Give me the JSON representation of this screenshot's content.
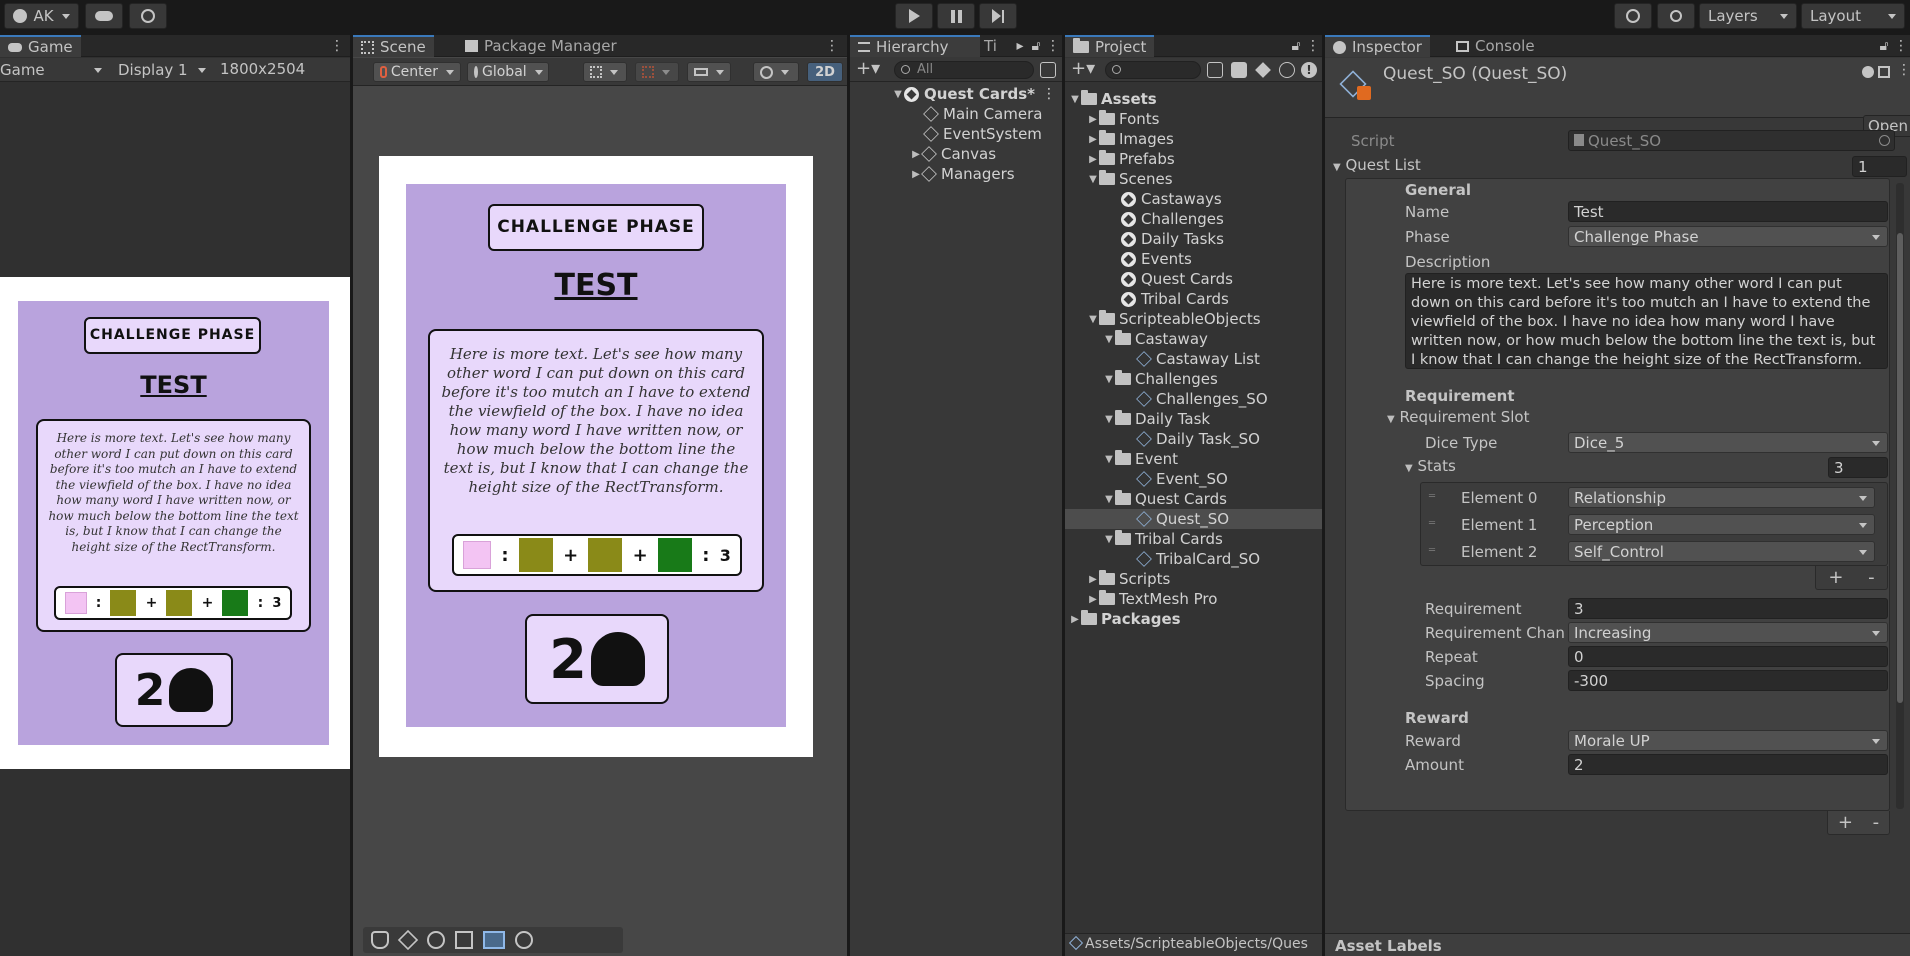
{
  "toolbar": {
    "account": "AK",
    "layers": "Layers",
    "layout": "Layout"
  },
  "game": {
    "tab": "Game",
    "view_mode": "Game",
    "display": "Display 1",
    "resolution": "1800x2504"
  },
  "scene": {
    "tab": "Scene",
    "tab2": "Package Manager",
    "pivot": "Center",
    "space": "Global",
    "mode2d": "2D"
  },
  "card": {
    "phase": "CHALLENGE PHASE",
    "title": "TEST",
    "description": "Here is more text. Let's see how many other word I can put down on this card before it's too mutch an I have to extend the viewfield of the box. I have no idea how many word I have written now, or how much below the bottom line the text is, but I know that I can change the height size of the RectTransform.",
    "req_sep": ":",
    "plus": "+",
    "req_value": "3",
    "reward_number": "2"
  },
  "hierarchy": {
    "tab": "Hierarchy",
    "tab2": "Ti",
    "search_placeholder": "All",
    "items": [
      "Quest Cards*",
      "Main Camera",
      "EventSystem",
      "Canvas",
      "Managers"
    ]
  },
  "project": {
    "tab": "Project",
    "items": [
      "Assets",
      "Fonts",
      "Images",
      "Prefabs",
      "Scenes",
      "Castaways",
      "Challenges",
      "Daily Tasks",
      "Events",
      "Quest Cards",
      "Tribal Cards",
      "ScripteableObjects",
      "Castaway",
      "Castaway List",
      "Challenges",
      "Challenges_SO",
      "Daily Task",
      "Daily Task_SO",
      "Event",
      "Event_SO",
      "Quest Cards",
      "Quest_SO",
      "Tribal Cards",
      "TribalCard_SO",
      "Scripts",
      "TextMesh Pro",
      "Packages"
    ],
    "path": "Assets/ScripteableObjects/Ques"
  },
  "inspector": {
    "tab": "Inspector",
    "tab2": "Console",
    "title": "Quest_SO (Quest_SO)",
    "open": "Open",
    "script_label": "Script",
    "script_value": "Quest_SO",
    "quest_list": "Quest List",
    "quest_list_count": "1",
    "general": "General",
    "name_label": "Name",
    "name_value": "Test",
    "phase_label": "Phase",
    "phase_value": "Challenge Phase",
    "description_label": "Description",
    "description_value": "Here is more text. Let's see how many other word I can put down on this card before it's too mutch an I have to extend the viewfield of the box. I have no idea how many word I have written now, or how much below the bottom line the text is, but I know that I can change the height size of the RectTransform.",
    "requirement_header": "Requirement",
    "requirement_slot": "Requirement Slot",
    "dice_type_label": "Dice Type",
    "dice_type_value": "Dice_5",
    "stats_label": "Stats",
    "stats_count": "3",
    "elements": [
      {
        "label": "Element 0",
        "value": "Relationship"
      },
      {
        "label": "Element 1",
        "value": "Perception"
      },
      {
        "label": "Element 2",
        "value": "Self_Control"
      }
    ],
    "plus": "+",
    "minus": "-",
    "requirement_label": "Requirement",
    "requirement_value": "3",
    "req_change_label": "Requirement Chang",
    "req_change_value": "Increasing",
    "repeat_label": "Repeat",
    "repeat_value": "0",
    "spacing_label": "Spacing",
    "spacing_value": "-300",
    "reward_header": "Reward",
    "reward_label": "Reward",
    "reward_value": "Morale UP",
    "amount_label": "Amount",
    "amount_value": "2",
    "asset_labels": "Asset Labels"
  }
}
